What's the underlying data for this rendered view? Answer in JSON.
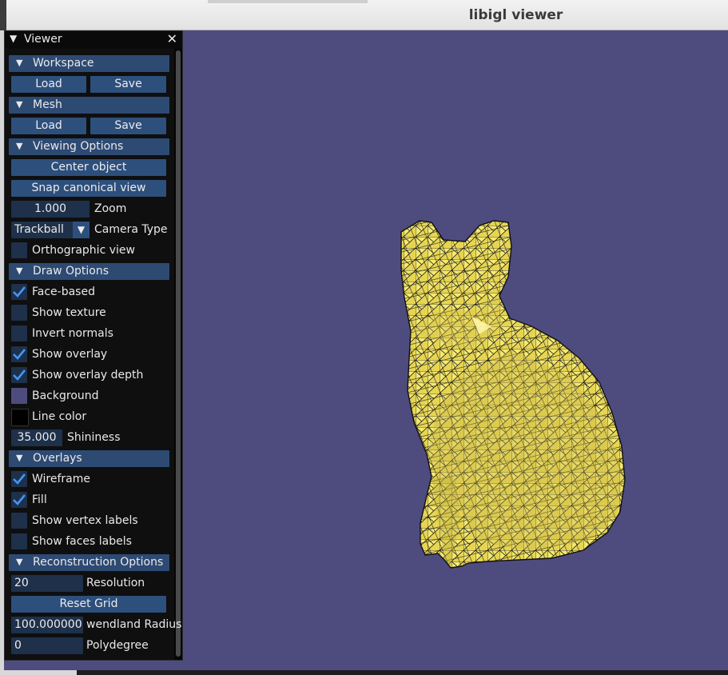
{
  "window": {
    "title": "libigl viewer"
  },
  "panel": {
    "title": "Viewer",
    "close": "✕"
  },
  "workspace": {
    "header": "Workspace",
    "load": "Load",
    "save": "Save"
  },
  "mesh": {
    "header": "Mesh",
    "load": "Load",
    "save": "Save"
  },
  "viewing": {
    "header": "Viewing Options",
    "center": "Center object",
    "snap": "Snap canonical view",
    "zoom_value": "1.000",
    "zoom_label": "Zoom",
    "camera_value": "Trackball",
    "camera_label": "Camera Type",
    "ortho_label": "Orthographic view",
    "ortho_checked": false
  },
  "draw": {
    "header": "Draw Options",
    "face_based": "Face-based",
    "face_based_checked": true,
    "show_texture": "Show texture",
    "show_texture_checked": false,
    "invert_normals": "Invert normals",
    "invert_normals_checked": false,
    "show_overlay": "Show overlay",
    "show_overlay_checked": true,
    "show_overlay_depth": "Show overlay depth",
    "show_overlay_depth_checked": true,
    "background": "Background",
    "background_color": "#4e4c7e",
    "line_color": "Line color",
    "line_color_value": "#000000",
    "shininess_value": "35.000",
    "shininess_label": "Shininess"
  },
  "overlays": {
    "header": "Overlays",
    "wireframe": "Wireframe",
    "wireframe_checked": true,
    "fill": "Fill",
    "fill_checked": true,
    "vertex_labels": "Show vertex labels",
    "vertex_labels_checked": false,
    "face_labels": "Show faces labels",
    "face_labels_checked": false
  },
  "reconstruction": {
    "header": "Reconstruction Options",
    "resolution_value": "20",
    "resolution_label": "Resolution",
    "reset": "Reset Grid",
    "radius_value": "100.000000",
    "radius_label": "wendland Radius",
    "poly_value": "0",
    "poly_label": "Polydegree"
  },
  "colors": {
    "header": "#2d4a73",
    "button": "#2d4f7c",
    "frame": "#1e304a",
    "check": "#4296fa",
    "mesh_fill": "#f2e464"
  }
}
